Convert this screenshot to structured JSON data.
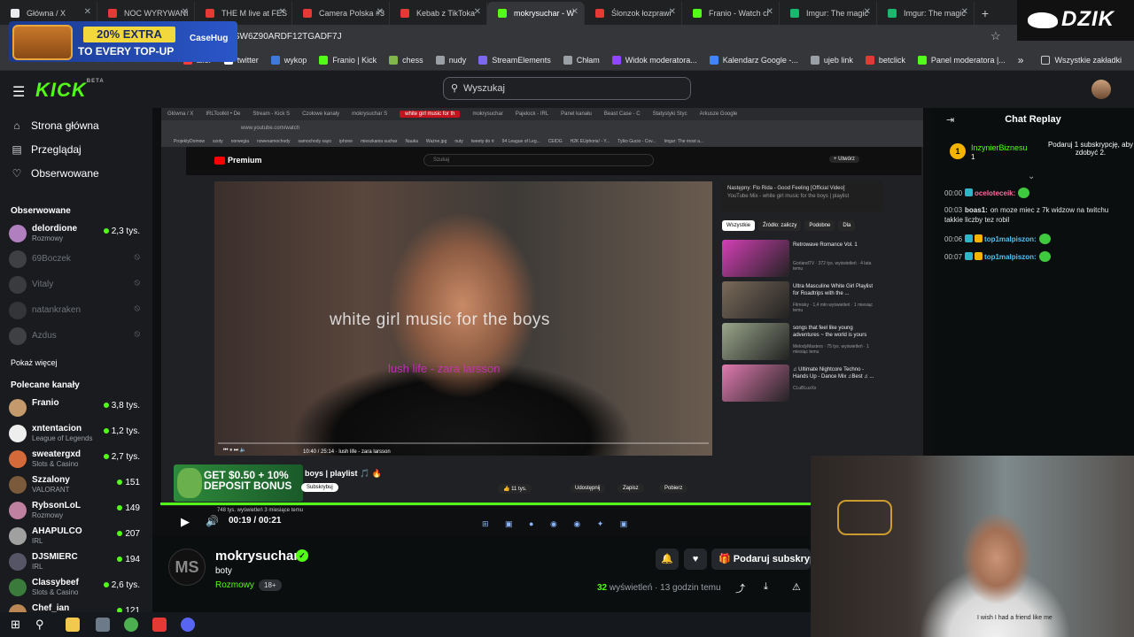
{
  "browser": {
    "tabs": [
      {
        "title": "Główna / X",
        "color": "#e8eaed",
        "active": false
      },
      {
        "title": "NOC WYRYWANI",
        "color": "#e53935",
        "active": false
      },
      {
        "title": "THE M live at FES",
        "color": "#e53935",
        "active": false
      },
      {
        "title": "Camera Polska #3",
        "color": "#e53935",
        "active": false
      },
      {
        "title": "Kebab z TikToka",
        "color": "#e53935",
        "active": false
      },
      {
        "title": "mokrysuchar - W",
        "color": "#53fc18",
        "active": true
      },
      {
        "title": "Ślonzok łozprawi",
        "color": "#e53935",
        "active": false
      },
      {
        "title": "Franio - Watch cl",
        "color": "#53fc18",
        "active": false
      },
      {
        "title": "Imgur: The magic",
        "color": "#1bb76e",
        "active": false
      },
      {
        "title": "Imgur: The magic",
        "color": "#1bb76e",
        "active": false
      }
    ],
    "new_tab": "+",
    "url": "M0SW6Z90ARDF12TGADF7J",
    "star": "☆",
    "bookmarks": [
      {
        "label": "alior",
        "color": "#ff3b3b"
      },
      {
        "label": "twitter",
        "color": "#ffffff"
      },
      {
        "label": "wykop",
        "color": "#3c7bd7"
      },
      {
        "label": "Franio | Kick",
        "color": "#53fc18"
      },
      {
        "label": "chess",
        "color": "#81b64c"
      },
      {
        "label": "nudy",
        "color": "#9aa0a6"
      },
      {
        "label": "StreamElements",
        "color": "#7b68ee"
      },
      {
        "label": "Chłam",
        "color": "#9aa0a6"
      },
      {
        "label": "Widok moderatora...",
        "color": "#9146ff"
      },
      {
        "label": "Kalendarz Google -...",
        "color": "#4285f4"
      },
      {
        "label": "ujeb link",
        "color": "#9aa0a6"
      },
      {
        "label": "betclick",
        "color": "#e53935"
      },
      {
        "label": "Panel moderatora |...",
        "color": "#53fc18"
      }
    ],
    "bookmarks_more": "»",
    "all_bookmarks": "Wszystkie zakładki"
  },
  "overlay": {
    "promo_line1": "20% EXTRA",
    "promo_line2": "TO EVERY TOP-UP",
    "promo_brand": "CaseHug",
    "dzik": "DZIK"
  },
  "kick": {
    "logo": "KICK",
    "logo_beta": "BETA",
    "search_placeholder": "Wyszukaj",
    "nav": [
      {
        "label": "Strona główna",
        "icon": "⌂"
      },
      {
        "label": "Przeglądaj",
        "icon": "▤"
      },
      {
        "label": "Obserwowane",
        "icon": "♡"
      }
    ],
    "followed_title": "Obserwowane",
    "followed": [
      {
        "name": "delordione",
        "category": "Rozmowy",
        "viewers": "2,3 tys.",
        "live": true,
        "color": "#b07fc0"
      },
      {
        "name": "69Boczek",
        "category": "",
        "viewers": "",
        "live": false,
        "color": "#888"
      },
      {
        "name": "Vitaly",
        "category": "",
        "viewers": "",
        "live": false,
        "color": "#777"
      },
      {
        "name": "natankraken",
        "category": "",
        "viewers": "",
        "live": false,
        "color": "#666"
      },
      {
        "name": "Azdus",
        "category": "",
        "viewers": "",
        "live": false,
        "color": "#888"
      }
    ],
    "show_more": "Pokaż więcej",
    "recommended_title": "Polecane kanały",
    "recommended": [
      {
        "name": "Franio",
        "category": "",
        "viewers": "3,8 tys.",
        "color": "#c49a6c"
      },
      {
        "name": "xntentacion",
        "category": "League of Legends",
        "viewers": "1,2 tys.",
        "color": "#eee"
      },
      {
        "name": "sweatergxd",
        "category": "Slots & Casino",
        "viewers": "2,7 tys.",
        "color": "#d46a3a"
      },
      {
        "name": "Szzalony",
        "category": "VALORANT",
        "viewers": "151",
        "color": "#7a5a3a"
      },
      {
        "name": "RybsonLoL",
        "category": "Rozmowy",
        "viewers": "149",
        "color": "#c080a0"
      },
      {
        "name": "AHAPULCO",
        "category": "IRL",
        "viewers": "207",
        "color": "#a0a0a0"
      },
      {
        "name": "DJSMIERC",
        "category": "IRL",
        "viewers": "194",
        "color": "#556"
      },
      {
        "name": "Classybeef",
        "category": "Slots & Casino",
        "viewers": "2,6 tys.",
        "color": "#3a7a3a"
      },
      {
        "name": "Chef_ian",
        "category": "",
        "viewers": "121",
        "color": "#bb8855"
      }
    ]
  },
  "inner": {
    "tabs": [
      "Główna / X",
      "IRLToolkit • De",
      "Stream - Kick S",
      "Czołowe kanały",
      "mokrysuchar S",
      "white girl music for th",
      "mokrysuchar",
      "Pajelock - IRL",
      "Panel kanału",
      "Beast Case - C",
      "Statystyki Styc",
      "Arkusze Google"
    ],
    "url": "www.youtube.com/watch",
    "bookmarks": [
      "ProjektyDomow",
      "szoty",
      "norwegia",
      "nowesamochody",
      "samochody xayo",
      "iphone",
      "mieszkania suchar",
      "Nauka",
      "Ważne.jpg",
      "nuty",
      "tweety do rt",
      "94 League of Leg...",
      "CEIDG",
      "H2K EUphoria! - Y...",
      "Tylko Gucio - Cov...",
      "Imgur: The most a..."
    ],
    "yt_logo": "Premium",
    "yt_search": "Szukaj",
    "yt_create": "+ Utwórz",
    "video_title_overlay": "white girl music for the boys",
    "video_song": "lush life - zara larsson",
    "video_time": "10:40 / 25:14 · lush life - zara larsson",
    "upnext_label": "Następny: Flo Rida - Good Feeling [Official Video]",
    "upnext_sub": "YouTube Mix - white girl music for the boys | playlist",
    "chips": [
      "Wszystkie",
      "Źródło: zaliczy",
      "Podobne",
      "Dla"
    ],
    "recs": [
      {
        "title": "Retrowave Romance Vol. 1",
        "meta": "GorlandTV · 372 tys. wyświetleń · 4 lata temu",
        "color": "#d43fb5"
      },
      {
        "title": "Ultra Masculine White Girl Playlist for Roadtrips with the ...",
        "meta": "Filmisky · 1,4 mln wyświetleń · 1 miesiąc temu",
        "color": "#7a6a5a"
      },
      {
        "title": "songs that feel like young adventures ~ the world is yours",
        "meta": "MelodyMasters · 75 tys. wyświetleń · 1 miesiąc temu",
        "color": "#9aa58a"
      },
      {
        "title": "♫ Ultimate Nightcore Techno - Hands Up - Dance Mix ♫Best ♫ ...",
        "meta": "CLuBLuxXx",
        "color": "#e07ab0"
      }
    ],
    "ad_text": "GET $0.50 + 10% DEPOSIT BONUS",
    "yt_video_title": "boys | playlist 🎵 🔥",
    "subscribe": "Subskrybuj",
    "likes": "11 tys.",
    "share": "Udostępnij",
    "save": "Zapisz",
    "download": "Pobierz",
    "views_line": "748 tys. wyświetleń 3 miesiące temu"
  },
  "player": {
    "play_icon": "▶",
    "volume_icon": "🔊",
    "time": "00:19 / 00:21"
  },
  "channel": {
    "avatar_text": "MS",
    "name": "mokrysuchar",
    "verified": "✓",
    "title": "boty",
    "category": "Rozmowy",
    "age": "18+",
    "views_count": "32",
    "views_label": "wyświetleń",
    "time_ago": "· 13 godzin temu",
    "gift_label": "Podaruj subskrypcje",
    "bell": "🔔",
    "heart": "♥"
  },
  "chat": {
    "title": "Chat Replay",
    "pinned_user": "InzynierBiznesu",
    "pinned_count": "1",
    "pinned_msg": "Podaruj 1 subskrypcję, aby zdobyć 2.",
    "messages": [
      {
        "ts": "00:00",
        "user": "oceloteceik:",
        "color": "#ff6b9d",
        "text": "",
        "emote": true,
        "badges": [
          "#2fb5c7"
        ]
      },
      {
        "ts": "00:03",
        "user": "boas1:",
        "color": "#e6e6e6",
        "text": "on moze miec z 7k widzow na twitchu takkie liczby tez robil",
        "emote": false,
        "badges": []
      },
      {
        "ts": "00:06",
        "user": "top1malpiszon:",
        "color": "#4fc3f7",
        "text": "",
        "emote": true,
        "badges": [
          "#2fb5c7",
          "#f4b400"
        ]
      },
      {
        "ts": "00:07",
        "user": "top1malpiszon:",
        "color": "#4fc3f7",
        "text": "",
        "emote": true,
        "badges": [
          "#2fb5c7",
          "#f4b400"
        ]
      }
    ]
  },
  "webcam": {
    "shirt_text": "I wish I had a friend like me"
  }
}
